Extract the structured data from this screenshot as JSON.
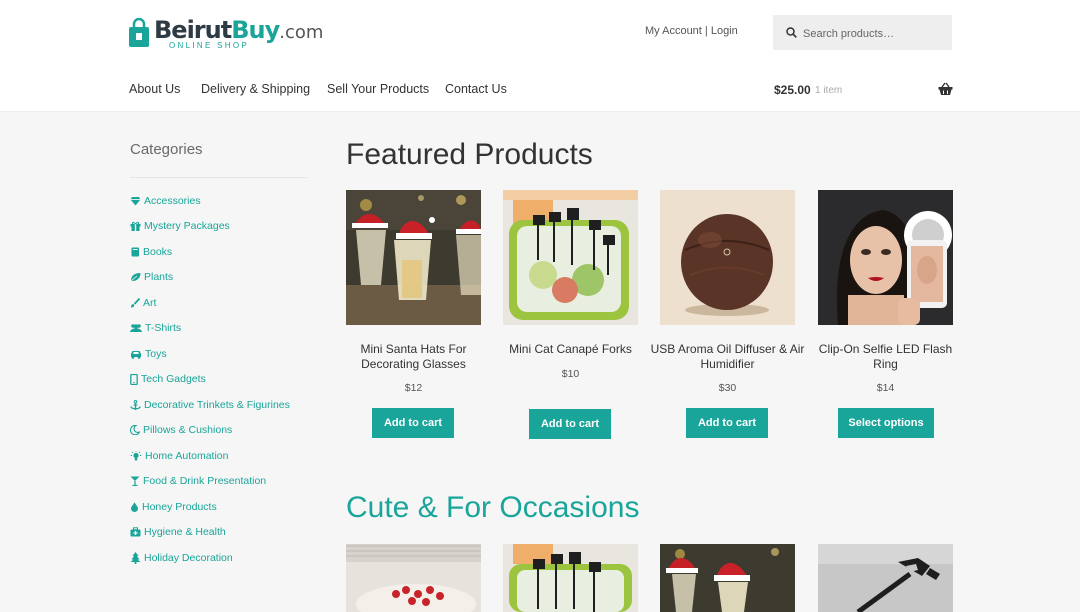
{
  "header": {
    "logo": {
      "word_main": "Beirut",
      "word_accent": "Buy",
      "word_suffix": ".com",
      "tagline": "ONLINE SHOP"
    },
    "account_link": "My Account | Login",
    "search": {
      "placeholder": "Search products…"
    },
    "nav": [
      "About Us",
      "Delivery & Shipping",
      "Sell Your Products",
      "Contact Us"
    ],
    "cart": {
      "total": "$25.00",
      "count": "1 item"
    }
  },
  "sidebar": {
    "title": "Categories",
    "items": [
      {
        "label": "Accessories",
        "icon": "diamond-icon"
      },
      {
        "label": "Mystery Packages",
        "icon": "gift-icon"
      },
      {
        "label": "Books",
        "icon": "book-icon"
      },
      {
        "label": "Plants",
        "icon": "leaf-icon"
      },
      {
        "label": "Art",
        "icon": "paintbrush-icon"
      },
      {
        "label": "T-Shirts",
        "icon": "users-icon"
      },
      {
        "label": "Toys",
        "icon": "car-icon"
      },
      {
        "label": "Tech Gadgets",
        "icon": "phone-icon"
      },
      {
        "label": "Decorative Trinkets & Figurines",
        "icon": "anchor-icon"
      },
      {
        "label": "Pillows & Cushions",
        "icon": "moon-icon"
      },
      {
        "label": "Home Automation",
        "icon": "lightbulb-icon"
      },
      {
        "label": "Food & Drink Presentation",
        "icon": "cocktail-icon"
      },
      {
        "label": "Honey Products",
        "icon": "droplet-icon"
      },
      {
        "label": "Hygiene & Health",
        "icon": "medkit-icon"
      },
      {
        "label": "Holiday Decoration",
        "icon": "tree-icon"
      }
    ]
  },
  "featured": {
    "title": "Featured Products",
    "products": [
      {
        "name": "Mini Santa Hats For Decorating Glasses",
        "price": "$12",
        "button": "Add to cart"
      },
      {
        "name": "Mini Cat Canapé Forks",
        "price": "$10",
        "button": "Add to cart"
      },
      {
        "name": "USB Aroma Oil Diffuser & Air Humidifier",
        "price": "$30",
        "button": "Add to cart"
      },
      {
        "name": "Clip-On Selfie LED Flash Ring",
        "price": "$14",
        "button": "Select options"
      }
    ]
  },
  "occasions": {
    "title": "Cute & For Occasions"
  },
  "colors": {
    "accent": "#19a599",
    "page_bg": "#f6f6f6",
    "header_bg": "#ffffff"
  }
}
